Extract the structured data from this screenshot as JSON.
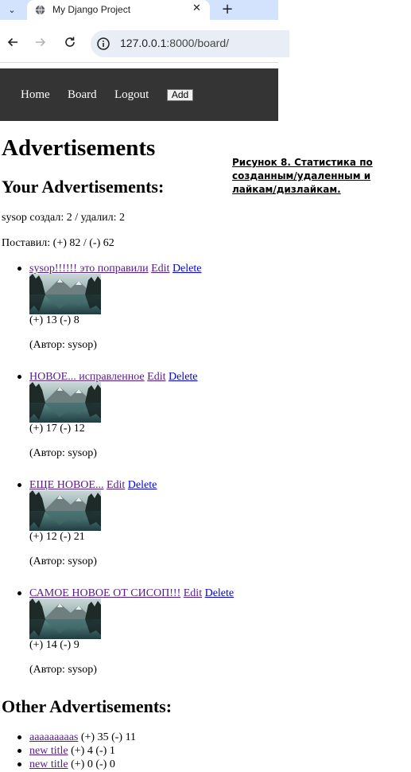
{
  "browser": {
    "tab_title": "My Django Project",
    "url_host": "127.0.0.1",
    "url_rest": ":8000/board/"
  },
  "nav": {
    "home": "Home",
    "board": "Board",
    "logout": "Logout",
    "add": "Add"
  },
  "page": {
    "title": "Advertisements",
    "your_heading": "Your Advertisements:",
    "created_deleted": "sysop создал: 2 / удалил: 2",
    "likes": "Поставил: (+) 82 / (-) 62",
    "other_heading": "Other Advertisements:"
  },
  "caption": "Рисунок 8. Статистика по созданным/удаленным и лайкам/дизлайкам.",
  "your_ads": [
    {
      "title": "sysop!!!!!! это поправили",
      "edit": "Edit",
      "delete": "Delete",
      "votes": "(+) 13 (-) 8",
      "author": "(Автор: sysop)"
    },
    {
      "title": "НОВОЕ... исправленное",
      "edit": "Edit",
      "delete": "Delete",
      "votes": "(+) 17 (-) 12",
      "author": "(Автор: sysop)"
    },
    {
      "title": "ЕЩЕ НОВОЕ...",
      "edit": "Edit",
      "delete": "Delete",
      "votes": "(+) 12 (-) 21",
      "author": "(Автор: sysop)"
    },
    {
      "title": "САМОЕ НОВОЕ ОТ СИСОП!!!",
      "edit": "Edit",
      "delete": "Delete",
      "votes": "(+) 14 (-) 9",
      "author": "(Автор: sysop)"
    }
  ],
  "other_ads": [
    {
      "title": "aaaaaaaaas",
      "votes": "(+) 35 (-) 11"
    },
    {
      "title": "new title",
      "votes": "(+) 4 (-) 1"
    },
    {
      "title": "new title",
      "votes": "(+) 0 (-) 0"
    }
  ]
}
